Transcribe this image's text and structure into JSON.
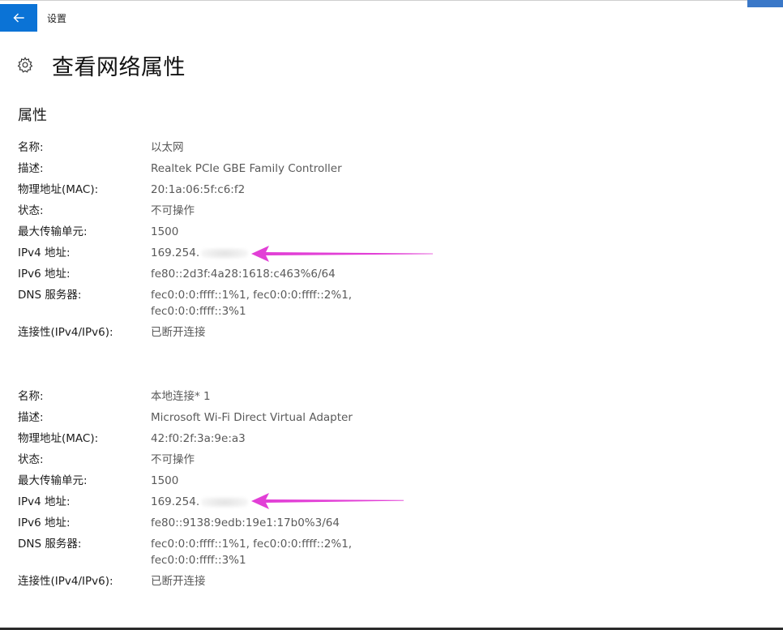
{
  "window": {
    "app_title": "设置",
    "back_icon": "arrow-left-icon"
  },
  "header": {
    "title": "查看网络属性",
    "icon": "gear-icon"
  },
  "section": {
    "title": "属性"
  },
  "colors": {
    "accent": "#0b73d6",
    "arrow": "#e23fd6"
  },
  "adapters": [
    {
      "rows": [
        {
          "label": "名称:",
          "value": "以太网"
        },
        {
          "label": "描述:",
          "value": "Realtek PCIe GBE Family Controller"
        },
        {
          "label": "物理地址(MAC):",
          "value": "20:1a:06:5f:c6:f2"
        },
        {
          "label": "状态:",
          "value": "不可操作"
        },
        {
          "label": "最大传输单元:",
          "value": "1500"
        },
        {
          "label": "IPv4 地址:",
          "value": "169.254."
        },
        {
          "label": "IPv6 地址:",
          "value": "fe80::2d3f:4a28:1618:c463%6/64"
        },
        {
          "label": "DNS 服务器:",
          "value": "fec0:0:0:ffff::1%1, fec0:0:0:ffff::2%1,\nfec0:0:0:ffff::3%1"
        },
        {
          "label": "连接性(IPv4/IPv6):",
          "value": "已断开连接"
        }
      ]
    },
    {
      "rows": [
        {
          "label": "名称:",
          "value": "本地连接* 1"
        },
        {
          "label": "描述:",
          "value": "Microsoft Wi-Fi Direct Virtual Adapter"
        },
        {
          "label": "物理地址(MAC):",
          "value": "42:f0:2f:3a:9e:a3"
        },
        {
          "label": "状态:",
          "value": "不可操作"
        },
        {
          "label": "最大传输单元:",
          "value": "1500"
        },
        {
          "label": "IPv4 地址:",
          "value": "169.254."
        },
        {
          "label": "IPv6 地址:",
          "value": "fe80::9138:9edb:19e1:17b0%3/64"
        },
        {
          "label": "DNS 服务器:",
          "value": "fec0:0:0:ffff::1%1, fec0:0:0:ffff::2%1,\nfec0:0:0:ffff::3%1"
        },
        {
          "label": "连接性(IPv4/IPv6):",
          "value": "已断开连接"
        }
      ]
    }
  ]
}
